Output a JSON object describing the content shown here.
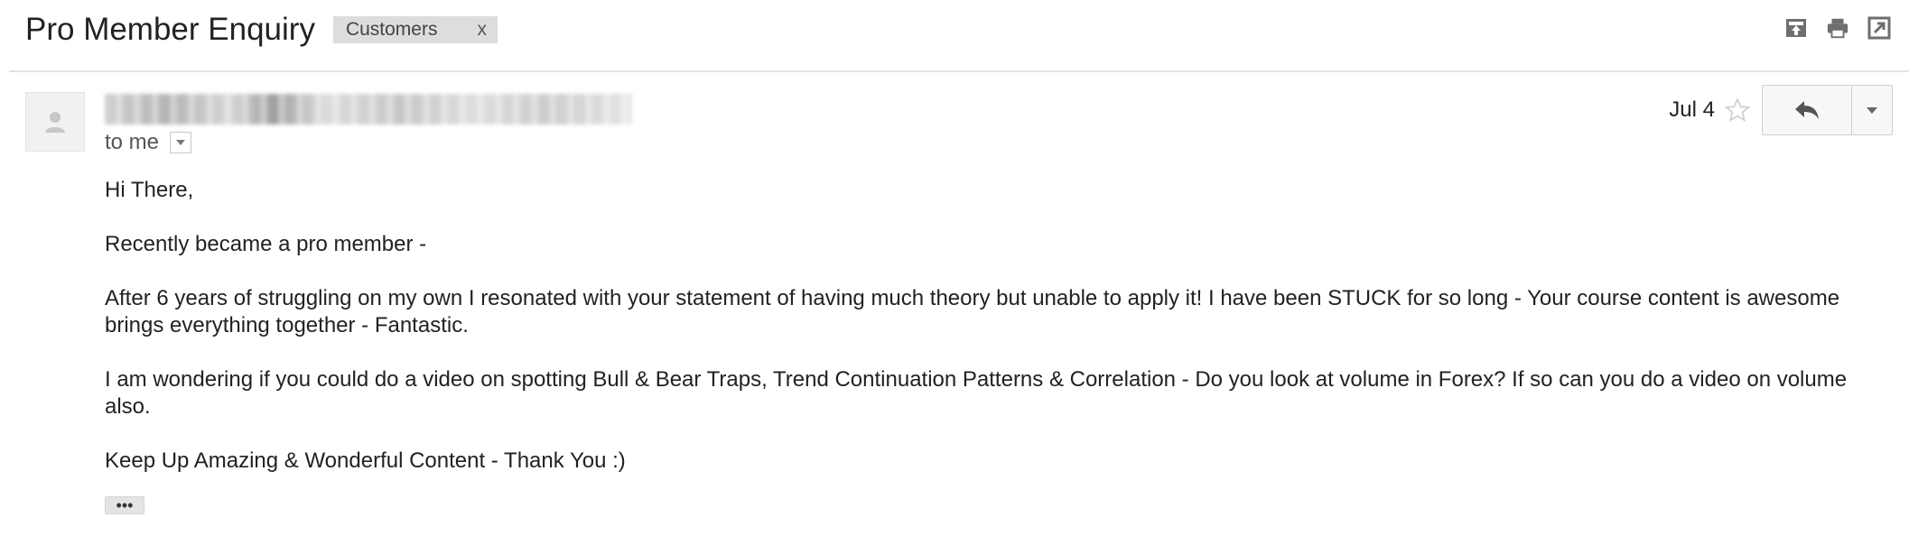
{
  "subject": "Pro Member Enquiry",
  "label": {
    "text": "Customers",
    "remove": "x"
  },
  "recipient": {
    "text": "to me"
  },
  "date": "Jul 4",
  "body": {
    "greeting": "Hi There,",
    "p1": "Recently became a pro member -",
    "p2": "After 6 years of struggling on my own I resonated with your statement of having much theory but unable to apply it! I have been STUCK for so long - Your course content is awesome brings everything together - Fantastic.",
    "p3": "I am wondering if you could do a video on spotting Bull & Bear Traps, Trend Continuation Patterns & Correlation - Do you look at volume in Forex? If so can you do a video on volume also.",
    "p4": "Keep Up Amazing & Wonderful Content - Thank You :)"
  },
  "trimmed_content_label": "•••",
  "icons": {
    "archive": "archive-icon",
    "print": "print-icon",
    "open_new": "open-in-new-window-icon",
    "avatar": "person-icon",
    "star": "star-outline-icon",
    "reply": "reply-icon",
    "more": "caret-down-icon"
  },
  "colors": {
    "label_bg": "#dddddd",
    "text": "#222222",
    "muted": "#555555"
  }
}
